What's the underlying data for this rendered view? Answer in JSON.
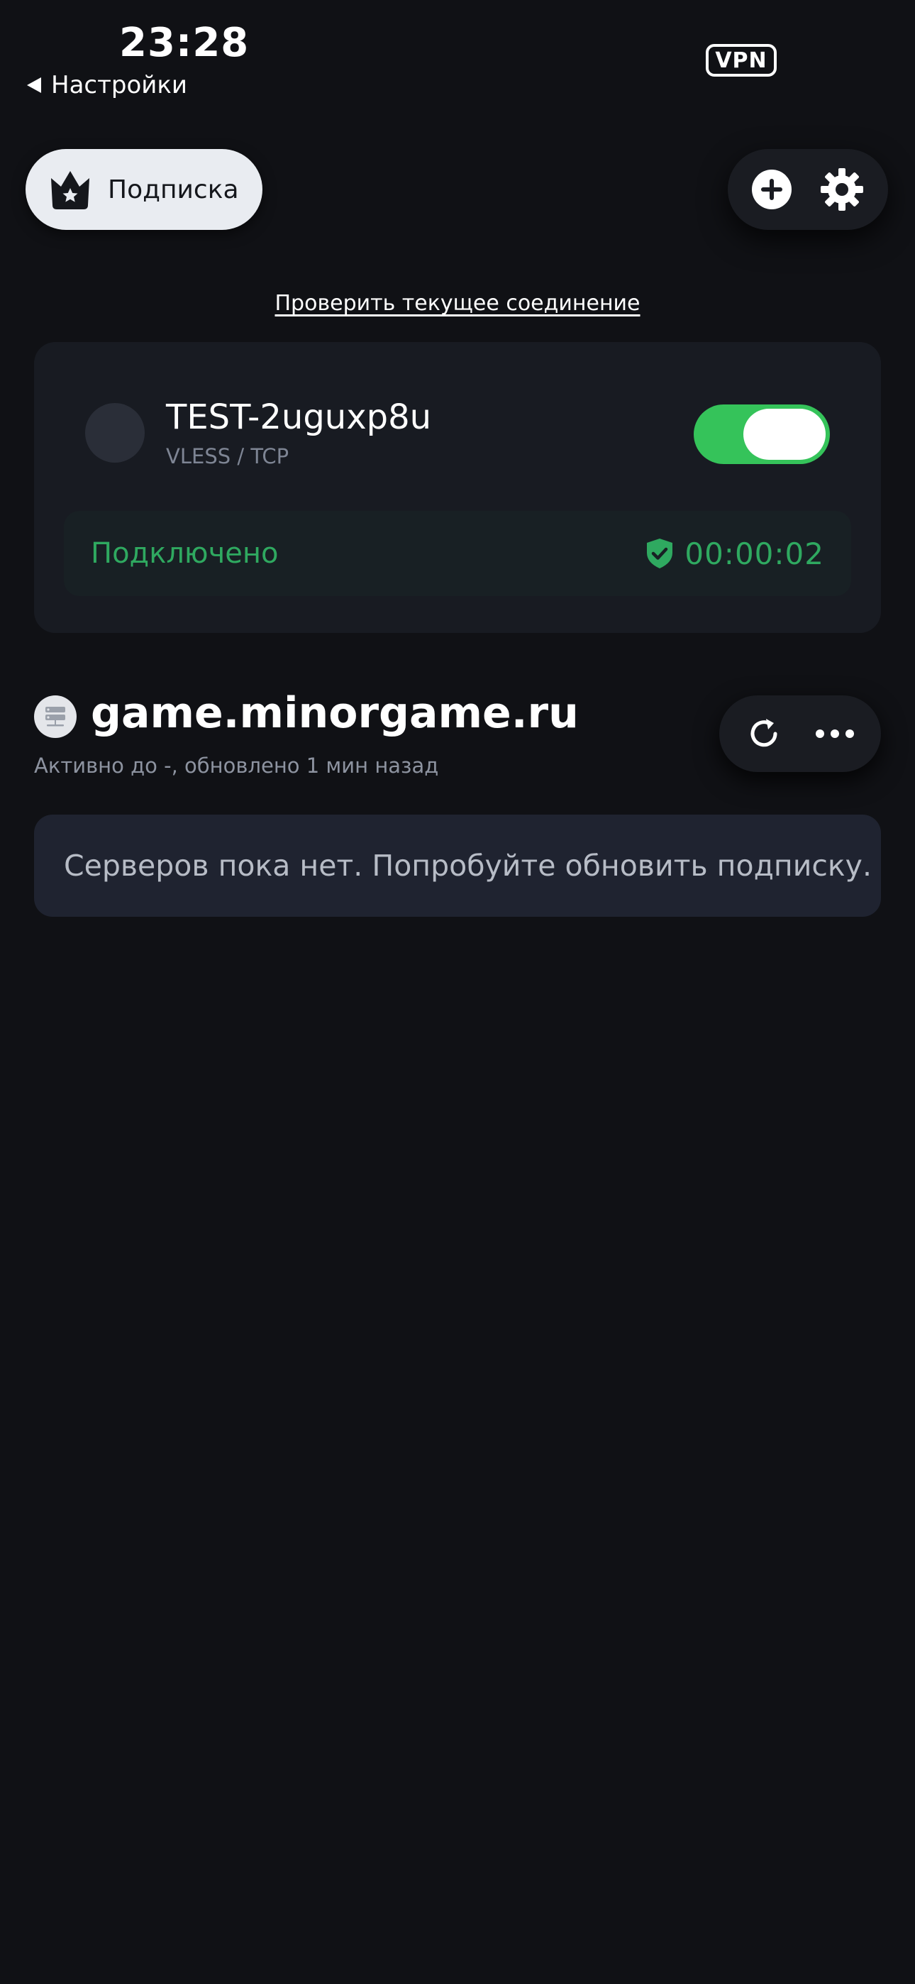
{
  "status_bar": {
    "time": "23:28",
    "back_label": "Настройки",
    "vpn_badge": "VPN"
  },
  "header": {
    "subscription_label": "Подписка"
  },
  "check_connection_link": "Проверить текущее соединение",
  "server_card": {
    "name": "TEST-2uguxp8u",
    "protocol": "VLESS / TCP",
    "toggle_on": true,
    "status_text": "Подключено",
    "timer": "00:00:02",
    "accent_color": "#35c35a"
  },
  "subscription": {
    "domain": "game.minorgame.ru",
    "meta": "Активно до -, обновлено 1 мин назад",
    "empty_message": "Серверов пока нет. Попробуйте обновить подписку."
  },
  "icons": {
    "crown": "crown-star-icon",
    "add": "plus-circle-icon",
    "settings": "gear-icon",
    "shield": "shield-check-icon",
    "refresh": "refresh-icon",
    "more": "more-dots-icon",
    "server": "server-icon"
  }
}
